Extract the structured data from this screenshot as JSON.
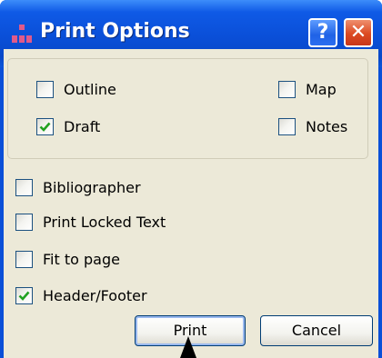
{
  "window": {
    "title": "Print Options",
    "help_glyph": "?",
    "close_glyph": "✕"
  },
  "group": {
    "options": [
      {
        "label": "Outline",
        "checked": false
      },
      {
        "label": "Map",
        "checked": false
      },
      {
        "label": "Draft",
        "checked": true
      },
      {
        "label": "Notes",
        "checked": false
      }
    ]
  },
  "options": [
    {
      "label": "Bibliographer",
      "checked": false
    },
    {
      "label": "Print Locked Text",
      "checked": false
    },
    {
      "label": "Fit to page",
      "checked": false
    },
    {
      "label": "Header/Footer",
      "checked": true
    }
  ],
  "buttons": {
    "print_label": "Print",
    "cancel_label": "Cancel"
  },
  "colors": {
    "title_bar": "#0a4fd8",
    "dialog_bg": "#ece9d8",
    "check_mark": "#21a121",
    "close_button": "#dc4a22"
  },
  "icons": {
    "app": "bar-chart-icon",
    "help": "help-icon",
    "close": "close-icon",
    "check": "check-icon",
    "cursor": "mouse-pointer-icon"
  }
}
